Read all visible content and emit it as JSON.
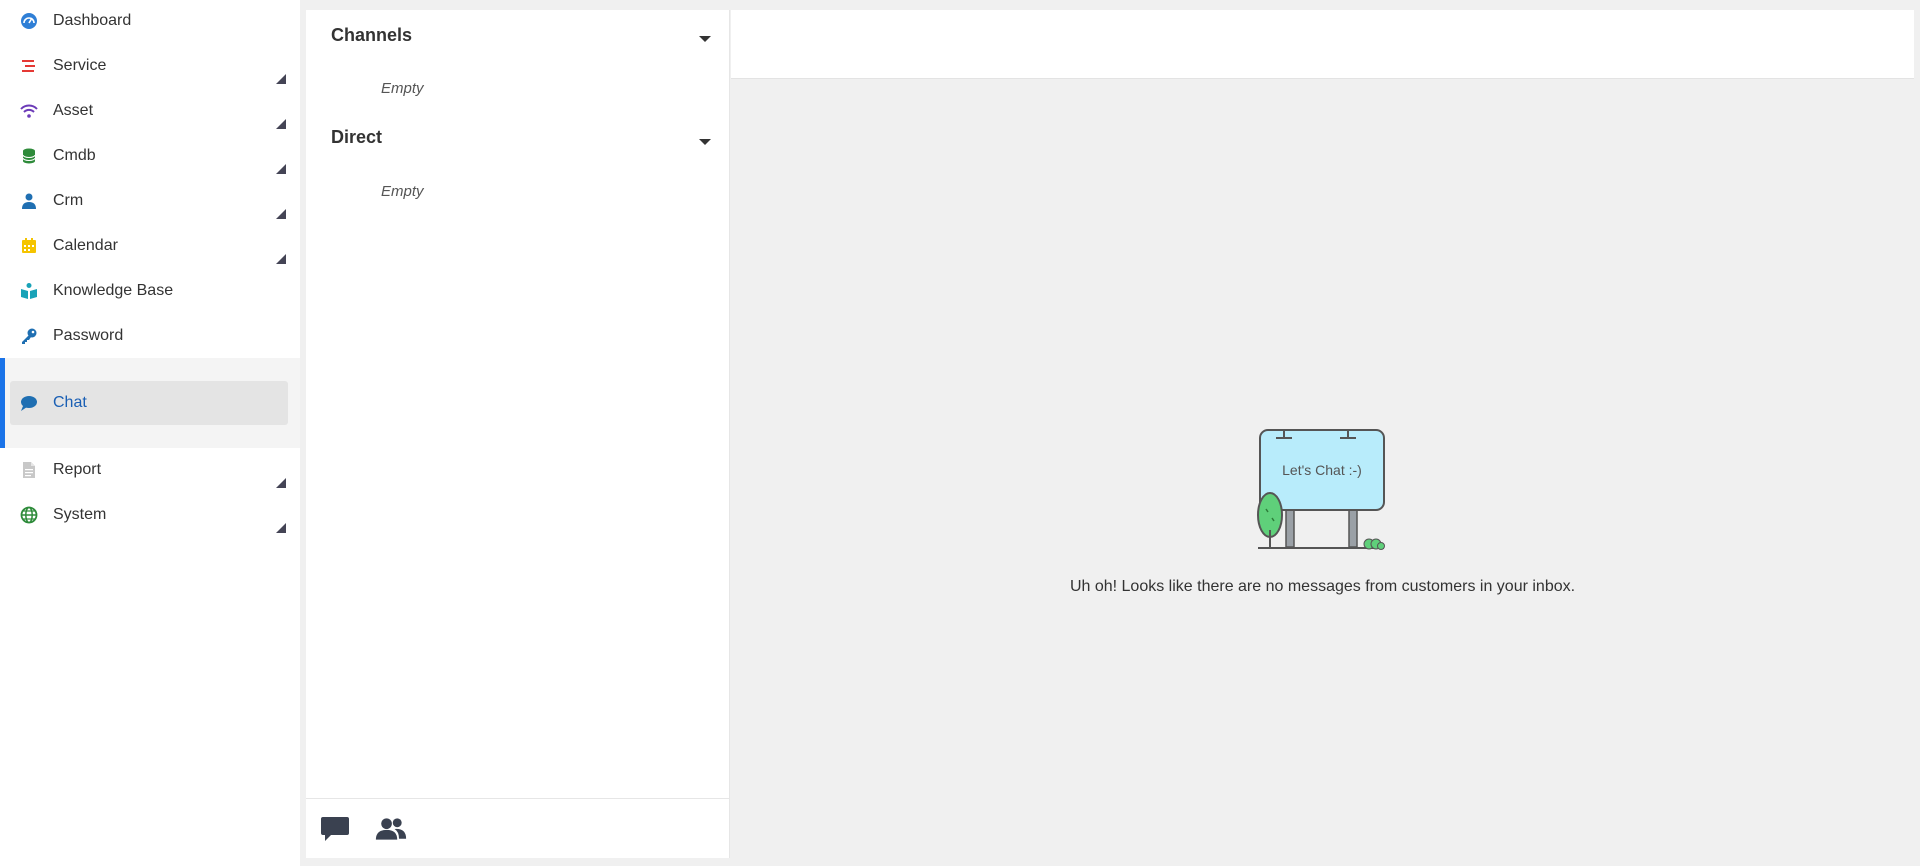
{
  "sidebar": {
    "items": [
      {
        "label": "Dashboard",
        "icon": "dashboard-icon",
        "color": "#2f7fd6",
        "has_caret": false
      },
      {
        "label": "Service",
        "icon": "service-icon",
        "color": "#e53935",
        "has_caret": true
      },
      {
        "label": "Asset",
        "icon": "wifi-icon",
        "color": "#6c3bb8",
        "has_caret": true
      },
      {
        "label": "Cmdb",
        "icon": "database-icon",
        "color": "#2e8b3a",
        "has_caret": true
      },
      {
        "label": "Crm",
        "icon": "user-icon",
        "color": "#1f6fb2",
        "has_caret": true
      },
      {
        "label": "Calendar",
        "icon": "calendar-icon",
        "color": "#f5c400",
        "has_caret": true
      },
      {
        "label": "Knowledge Base",
        "icon": "book-reader-icon",
        "color": "#19a3b8",
        "has_caret": false
      },
      {
        "label": "Password",
        "icon": "key-icon",
        "color": "#1f6fb2",
        "has_caret": false
      },
      {
        "label": "Chat",
        "icon": "comment-icon",
        "color": "#1f6fb2",
        "has_caret": false,
        "active": true
      },
      {
        "label": "Report",
        "icon": "file-icon",
        "color": "#bbbbbb",
        "has_caret": true
      },
      {
        "label": "System",
        "icon": "globe-icon",
        "color": "#2e8b3a",
        "has_caret": true
      }
    ]
  },
  "chat_panel": {
    "channels_title": "Channels",
    "channels_empty": "Empty",
    "direct_title": "Direct",
    "direct_empty": "Empty",
    "footer_icons": [
      "chat-bubble-icon",
      "users-icon"
    ]
  },
  "main": {
    "sign_text": "Let's Chat :-)",
    "empty_message": "Uh oh! Looks like there are no messages from customers in your inbox."
  }
}
